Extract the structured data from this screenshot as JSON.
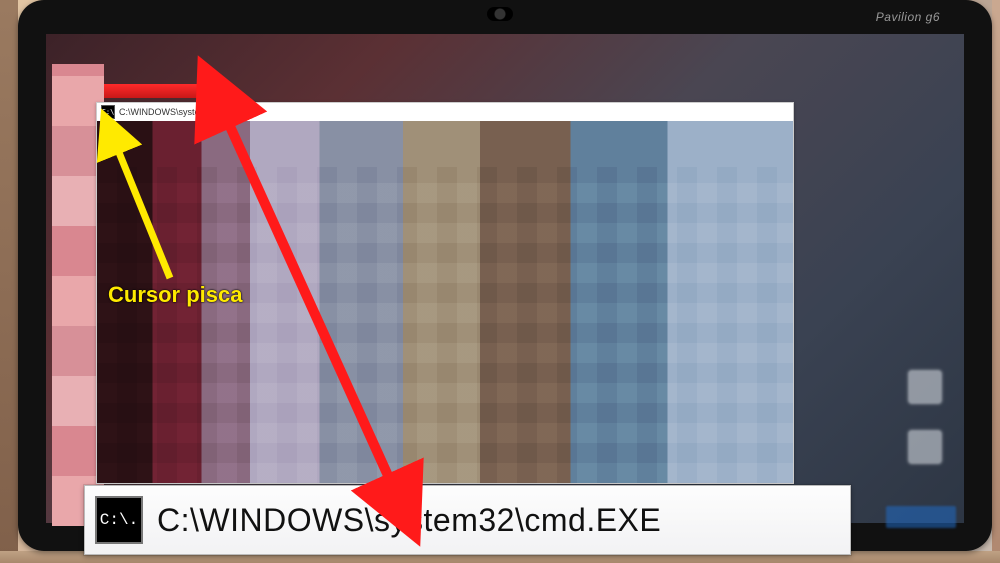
{
  "laptop": {
    "brand_label": "Pavilion g6"
  },
  "cmd_window": {
    "icon_glyph": "C:\\",
    "title": "C:\\WINDOWS\\system32\\cmd.EXE"
  },
  "zoom_callout": {
    "icon_glyph": "C:\\.",
    "title": "C:\\WINDOWS\\system32\\cmd.EXE"
  },
  "annotation": {
    "cursor_label": "Cursor pisca"
  },
  "colors": {
    "arrow_red": "#ff1a1a",
    "arrow_yellow": "#ffea00"
  }
}
